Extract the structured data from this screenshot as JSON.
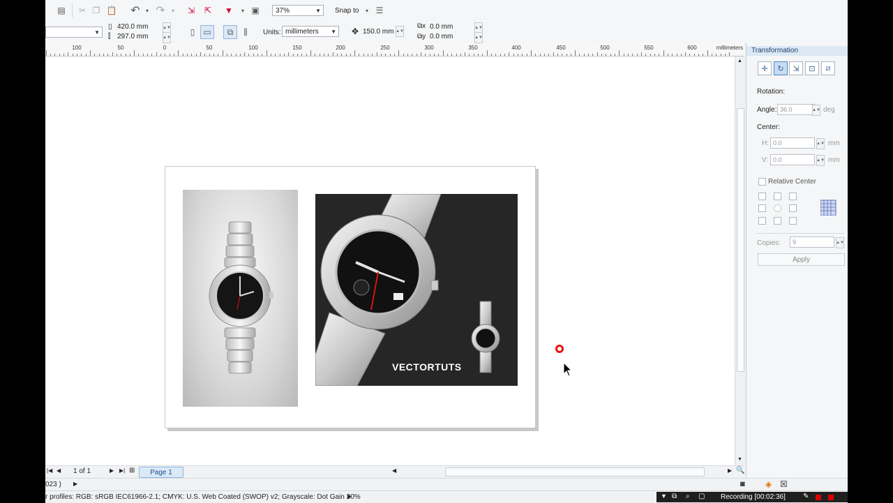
{
  "toolbar": {
    "zoom": "37%",
    "snap_to": "Snap to",
    "page_width": "420.0 mm",
    "page_height": "297.0 mm",
    "units_label": "Units:",
    "units_value": "millimeters",
    "nudge": "150.0 mm",
    "dup_x": "0.0 mm",
    "dup_y": "0.0 mm"
  },
  "ruler": {
    "labels": [
      "100",
      "50",
      "0",
      "50",
      "100",
      "150",
      "200",
      "250",
      "300",
      "350",
      "400",
      "450",
      "500",
      "550",
      "600"
    ],
    "unit": "millimeters"
  },
  "artwork": {
    "brand_text": "VECTORTUTS"
  },
  "docker": {
    "title": "Transformation",
    "rotation_label": "Rotation:",
    "angle_label": "Angle:",
    "angle_value": "36.0",
    "angle_unit": "deg",
    "center_label": "Center:",
    "h_label": "H:",
    "h_value": "0.0",
    "h_unit": "mm",
    "v_label": "V:",
    "v_value": "0.0",
    "v_unit": "mm",
    "relative_center": "Relative Center",
    "copies_label": "Copies:",
    "copies_value": "9",
    "apply_label": "Apply"
  },
  "navigation": {
    "page_count": "1 of 1",
    "page_tab": "Page 1"
  },
  "status": {
    "line1": "023 )",
    "line2": "r profiles: RGB: sRGB IEC61966-2.1; CMYK: U.S. Web Coated (SWOP) v2; Grayscale: Dot Gain 20%",
    "recording": "Recording [00:02:36]"
  }
}
